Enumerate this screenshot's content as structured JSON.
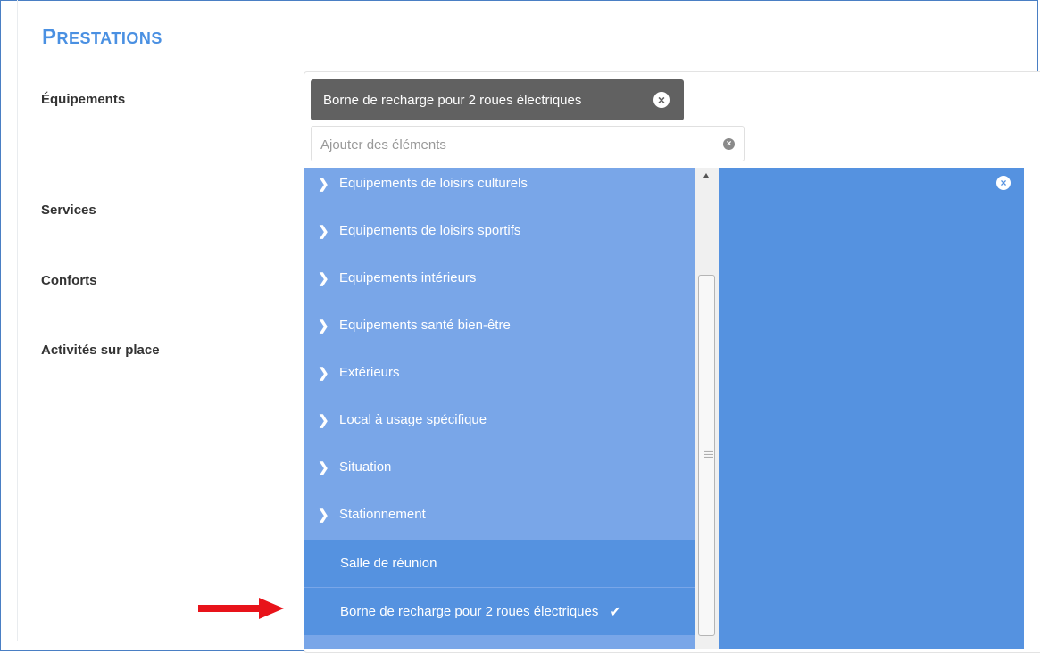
{
  "section": {
    "title_first": "P",
    "title_rest": "RESTATIONS"
  },
  "labels": {
    "equipements": "Équipements",
    "services": "Services",
    "conforts": "Conforts",
    "activites": "Activités sur place"
  },
  "selected_tag": {
    "label": "Borne de recharge pour 2 roues électriques",
    "remove_icon": "x-circle-icon"
  },
  "search": {
    "placeholder": "Ajouter des éléments",
    "value": ""
  },
  "dropdown": {
    "categories": [
      "Equipements de loisirs culturels",
      "Equipements de loisirs sportifs",
      "Equipements intérieurs",
      "Equipements santé bien-être",
      "Extérieurs",
      "Local à usage spécifique",
      "Situation",
      "Stationnement"
    ],
    "options": [
      {
        "label": "Salle de réunion",
        "selected": false
      },
      {
        "label": "Borne de recharge pour 2 roues électriques",
        "selected": true
      }
    ]
  },
  "colors": {
    "accent": "#4a90e2",
    "dropdown_bg": "#79a6e8",
    "dropdown_selected": "#5592e0",
    "tag_bg": "#616161",
    "arrow": "#e8131a"
  }
}
